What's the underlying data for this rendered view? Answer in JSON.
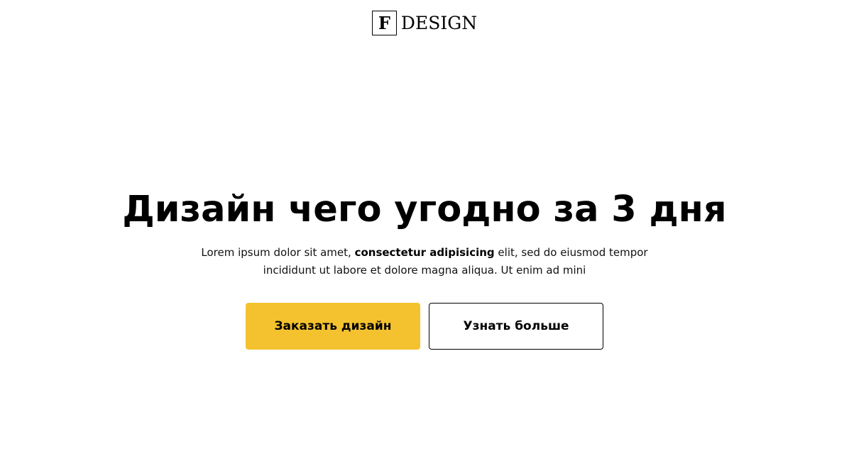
{
  "header": {
    "logo_mark": "F",
    "logo_text": "DESIGN"
  },
  "hero": {
    "title": "Дизайн чего угодно за 3 дня",
    "description_before": "Lorem ipsum dolor sit amet, ",
    "description_bold": "consectetur adipisicing",
    "description_after": " elit, sed do eiusmod tempor incididunt ut labore et dolore magna aliqua. Ut enim ad mini"
  },
  "buttons": {
    "primary_label": "Заказать дизайн",
    "secondary_label": "Узнать больше"
  },
  "colors": {
    "accent": "#f4c22f",
    "text": "#000000",
    "background": "#ffffff"
  }
}
